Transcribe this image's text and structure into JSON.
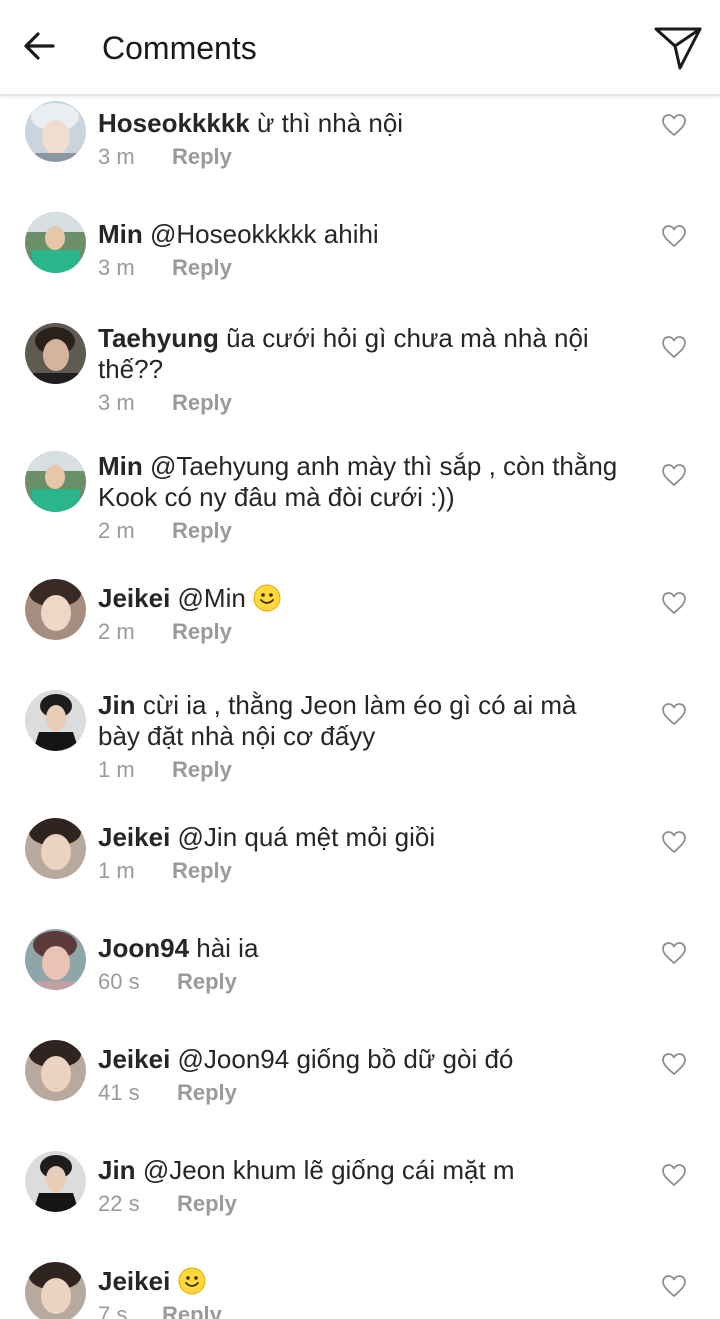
{
  "header": {
    "title": "Comments",
    "back_icon": "arrow-left-icon",
    "send_icon": "paper-plane-icon"
  },
  "colors": {
    "text": "#262626",
    "muted": "#9a9a9a",
    "emoji_fill": "#ffd93b"
  },
  "comments": [
    {
      "username": "Hoseokkkkk",
      "text": "ừ thì nhà nội",
      "time": "3 m",
      "reply": "Reply"
    },
    {
      "username": "Min",
      "text": "@Hoseokkkkk ahihi",
      "time": "3 m",
      "reply": "Reply"
    },
    {
      "username": "Taehyung",
      "text": "ũa cưới hỏi gì chưa mà nhà nội thế??",
      "time": "3 m",
      "reply": "Reply"
    },
    {
      "username": "Min",
      "text": "@Taehyung anh mày thì sắp , còn thằng Kook có ny đâu mà đòi cưới :))",
      "time": "2 m",
      "reply": "Reply"
    },
    {
      "username": "Jeikei",
      "text": "@Min",
      "emoji": "smiling-face-emoji",
      "time": "2 m",
      "reply": "Reply"
    },
    {
      "username": "Jin",
      "text": "cừi ia , thằng Jeon làm éo gì có ai mà bày đặt nhà nội cơ đấyy",
      "time": "1 m",
      "reply": "Reply"
    },
    {
      "username": "Jeikei",
      "text": "@Jin quá mệt mỏi giồi",
      "time": "1 m",
      "reply": "Reply"
    },
    {
      "username": "Joon94",
      "text": "hài ia",
      "time": "60 s",
      "reply": "Reply"
    },
    {
      "username": "Jeikei",
      "text": "@Joon94 giống bồ dữ gòi đó",
      "time": "41 s",
      "reply": "Reply"
    },
    {
      "username": "Jin",
      "text": "@Jeon khum lẽ giống cái mặt m",
      "time": "22 s",
      "reply": "Reply"
    },
    {
      "username": "Jeikei",
      "text": "",
      "emoji": "smiling-face-emoji",
      "time": "7 s",
      "reply": "Reply"
    }
  ]
}
